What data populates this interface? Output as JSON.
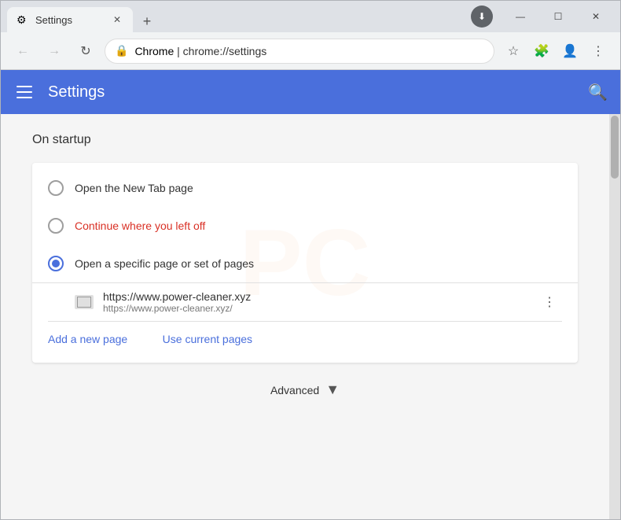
{
  "browser": {
    "tab": {
      "favicon_symbol": "⚙",
      "title": "Settings",
      "close_symbol": "✕"
    },
    "new_tab_symbol": "+",
    "window_controls": {
      "minimize": "—",
      "maximize": "☐",
      "close": "✕"
    },
    "download_symbol": "⬇"
  },
  "navbar": {
    "back_symbol": "←",
    "forward_symbol": "→",
    "reload_symbol": "↻",
    "lock_symbol": "🔒",
    "url_host": "Chrome",
    "url_separator": " | ",
    "url_path": "chrome://settings",
    "bookmark_symbol": "☆",
    "extensions_symbol": "🧩",
    "profile_symbol": "👤",
    "menu_symbol": "⋮"
  },
  "header": {
    "hamburger_label": "menu",
    "title": "Settings",
    "search_symbol": "🔍"
  },
  "content": {
    "section_title": "On startup",
    "options": [
      {
        "id": "new-tab",
        "label": "Open the New Tab page",
        "selected": false,
        "label_color": "normal"
      },
      {
        "id": "continue",
        "label": "Continue where you left off",
        "selected": false,
        "label_color": "red"
      },
      {
        "id": "specific",
        "label": "Open a specific page or set of pages",
        "selected": true,
        "label_color": "normal"
      }
    ],
    "page_entry": {
      "url_main": "https://www.power-cleaner.xyz",
      "url_sub": "https://www.power-cleaner.xyz/",
      "menu_symbol": "⋮"
    },
    "add_page_label": "Add a new page",
    "use_current_label": "Use current pages",
    "advanced": {
      "label": "Advanced",
      "arrow_symbol": "▼"
    }
  }
}
